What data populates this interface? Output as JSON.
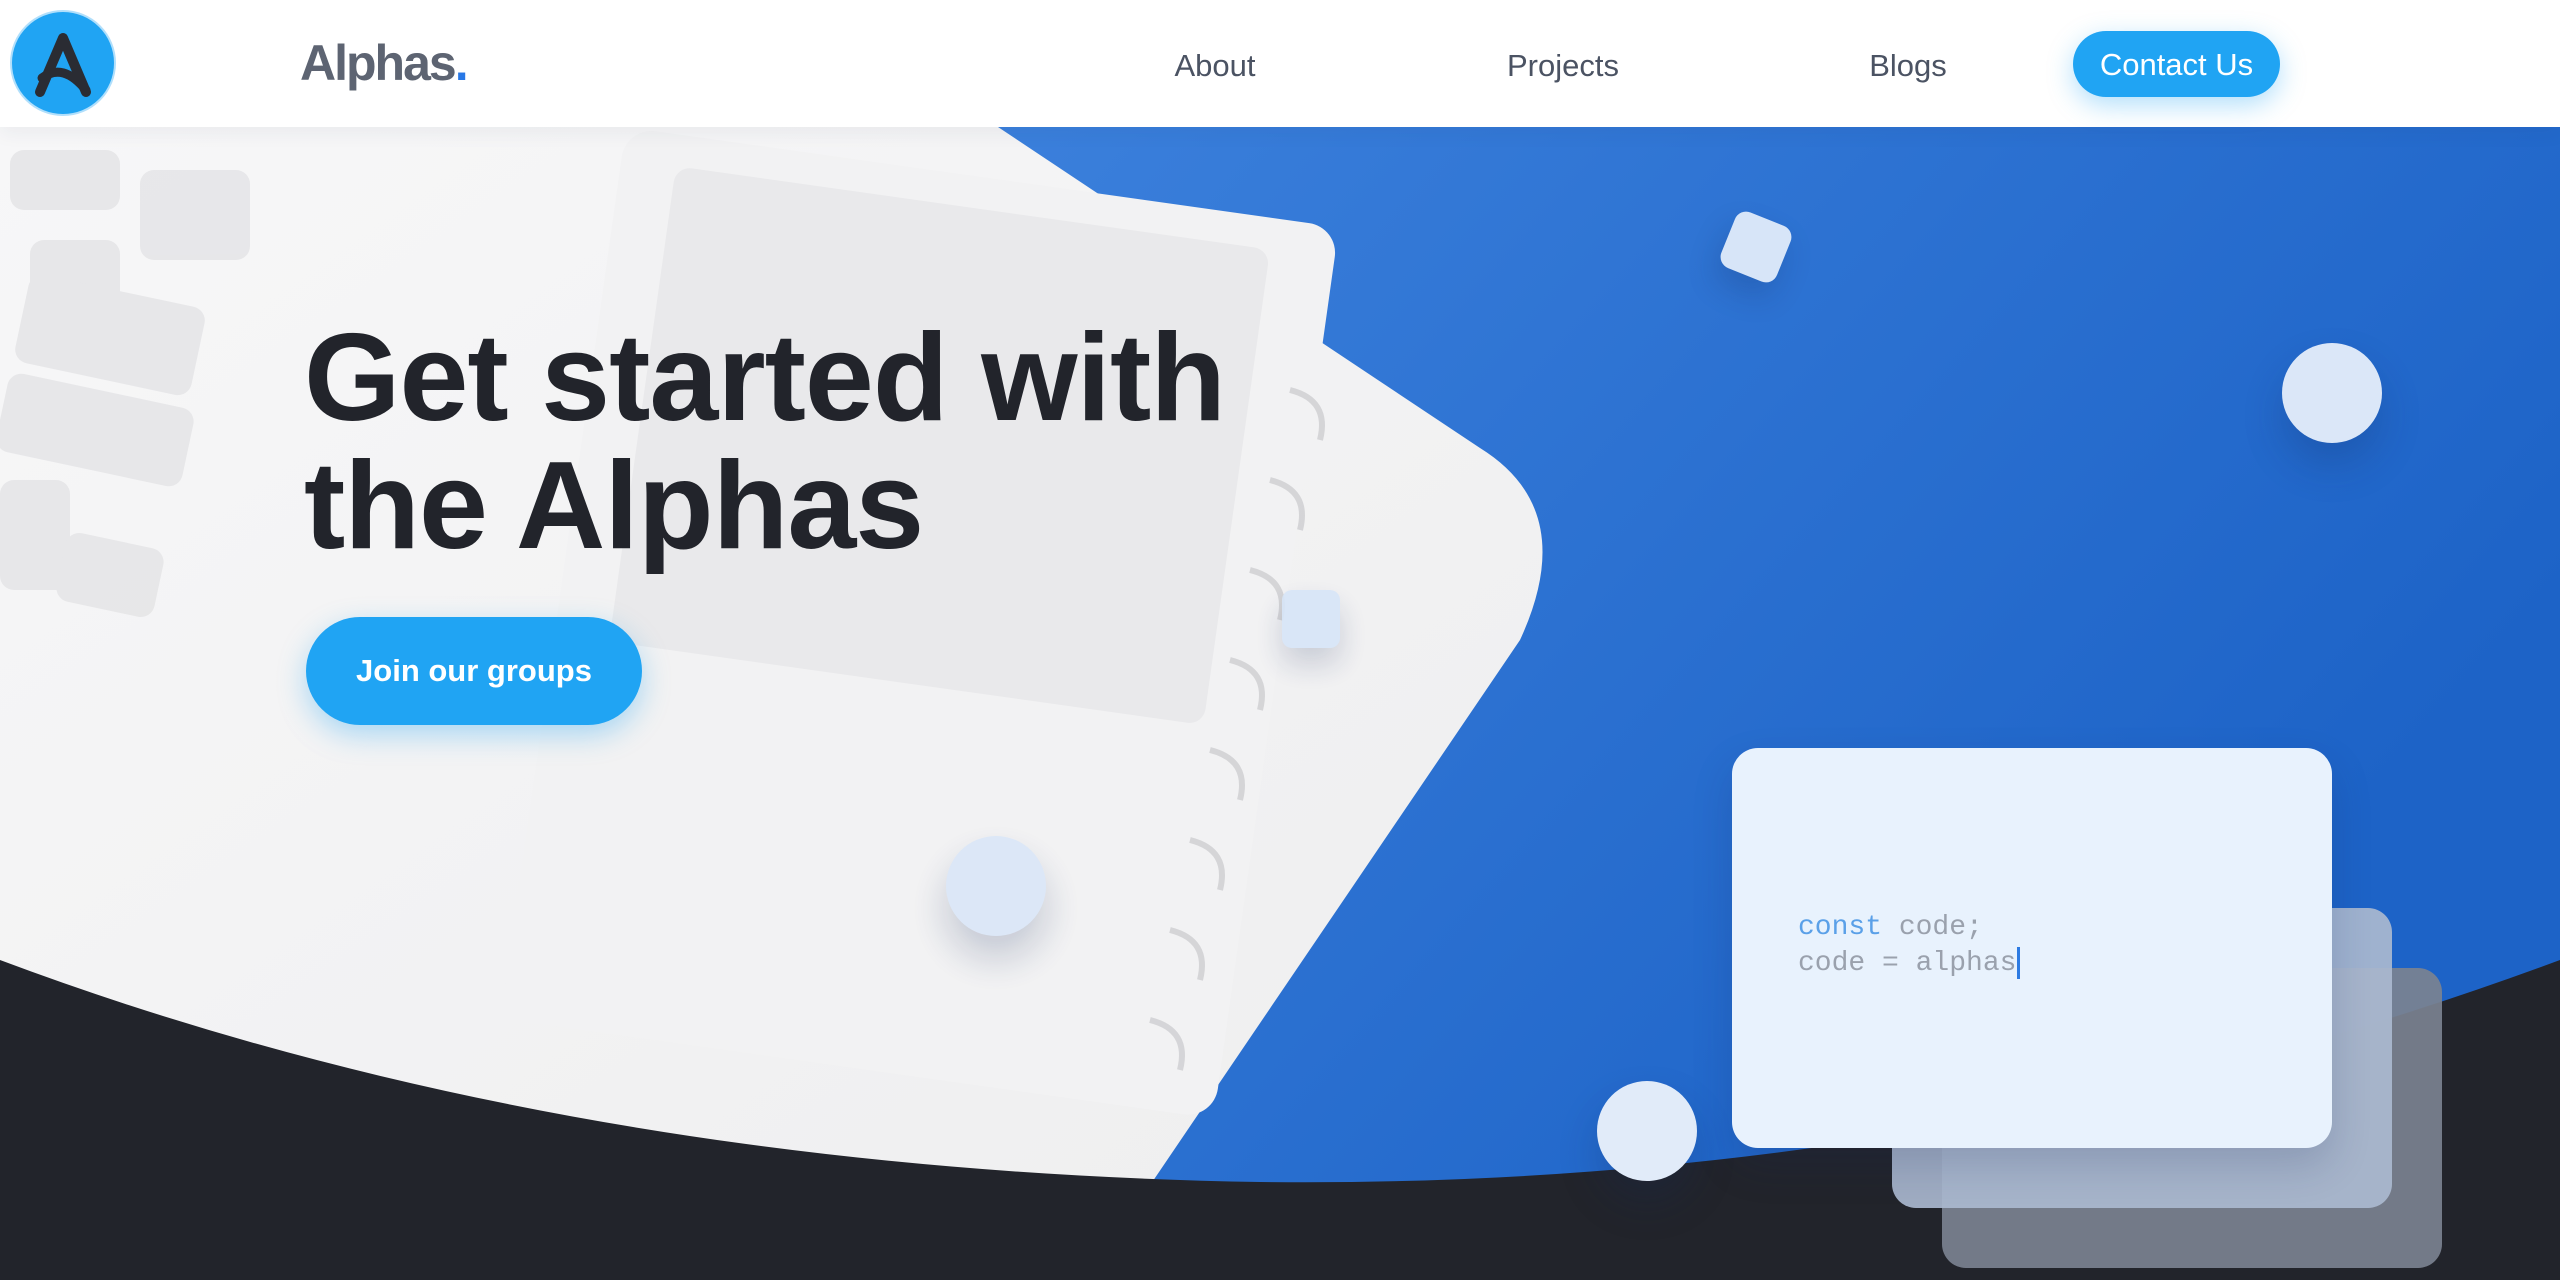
{
  "header": {
    "logo_icon": "alphas-a-logo-icon",
    "brand_name": "Alphas",
    "brand_dot": ".",
    "nav": {
      "about": "About",
      "projects": "Projects",
      "blogs": "Blogs",
      "contact": "Contact Us"
    }
  },
  "hero": {
    "headline_line1": "Get started with",
    "headline_line2": "the Alphas",
    "cta_label": "Join our groups"
  },
  "code_card": {
    "line1_keyword": "const",
    "line1_rest": " code;",
    "line2": "code = alphas"
  },
  "colors": {
    "accent": "#20a4f3",
    "brand_dot": "#2878e6",
    "hero_blue": "#2f7ae0",
    "dark": "#22242b"
  }
}
